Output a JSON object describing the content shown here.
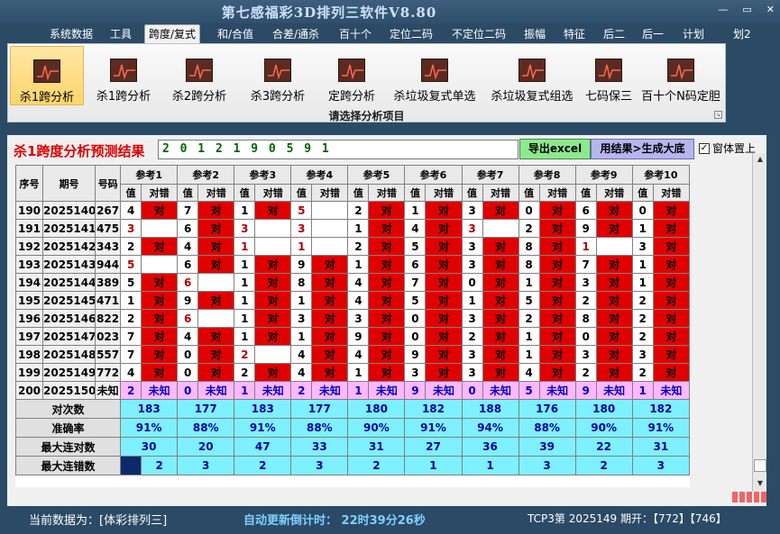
{
  "window": {
    "title": "第七感福彩3D排列三软件V8.80",
    "minimize": "—",
    "restore": "▭",
    "close": "✕"
  },
  "menu": [
    "系统数据",
    "工具",
    "跨度/复式",
    "和/合值",
    "合差/通杀",
    "百十个",
    "定位二码",
    "不定位二码",
    "振幅",
    "特征",
    "后二",
    "后一",
    "计划",
    "划2"
  ],
  "ribbon": {
    "buttons": [
      "杀1跨分析",
      "杀1跨分析",
      "杀2跨分析",
      "杀3跨分析",
      "定跨分析",
      "杀垃圾复式单选",
      "杀垃圾复式组选",
      "七码保三",
      "百十个N码定胆"
    ],
    "group_caption": "请选择分析项目",
    "launcher": "↘"
  },
  "panel": {
    "title": "杀1跨度分析预测结果",
    "result": "2 0 1 2 1 9 0 5 9 1",
    "export_btn": "导出excel",
    "gen_btn": "用结果>生成大底",
    "topmost_check": "✓",
    "topmost_label": "窗体置上"
  },
  "table": {
    "h_seq": "序号",
    "h_period": "期号",
    "h_num": "号码",
    "h_val": "值",
    "h_dc": "对错",
    "refs": [
      "参考1",
      "参考2",
      "参考3",
      "参考4",
      "参考5",
      "参考6",
      "参考7",
      "参考8",
      "参考9",
      "参考10"
    ],
    "rows": [
      {
        "seq": "190",
        "period": "2025140",
        "num": "267",
        "cells": [
          [
            "4",
            "对"
          ],
          [
            "7",
            "对"
          ],
          [
            "1",
            "对"
          ],
          [
            "5",
            ""
          ],
          [
            "2",
            "对"
          ],
          [
            "1",
            "对"
          ],
          [
            "3",
            "对"
          ],
          [
            "0",
            "对"
          ],
          [
            "6",
            "对"
          ],
          [
            "0",
            "对"
          ]
        ]
      },
      {
        "seq": "191",
        "period": "2025141",
        "num": "475",
        "cells": [
          [
            "3",
            ""
          ],
          [
            "6",
            "对"
          ],
          [
            "3",
            ""
          ],
          [
            "3",
            ""
          ],
          [
            "1",
            "对"
          ],
          [
            "4",
            "对"
          ],
          [
            "3",
            ""
          ],
          [
            "2",
            "对"
          ],
          [
            "9",
            "对"
          ],
          [
            "1",
            "对"
          ]
        ]
      },
      {
        "seq": "192",
        "period": "2025142",
        "num": "343",
        "cells": [
          [
            "2",
            "对"
          ],
          [
            "4",
            "对"
          ],
          [
            "1",
            ""
          ],
          [
            "1",
            ""
          ],
          [
            "2",
            "对"
          ],
          [
            "5",
            "对"
          ],
          [
            "3",
            "对"
          ],
          [
            "8",
            "对"
          ],
          [
            "1",
            ""
          ],
          [
            "3",
            "对"
          ]
        ]
      },
      {
        "seq": "193",
        "period": "2025143",
        "num": "944",
        "cells": [
          [
            "5",
            ""
          ],
          [
            "6",
            "对"
          ],
          [
            "1",
            "对"
          ],
          [
            "9",
            "对"
          ],
          [
            "1",
            "对"
          ],
          [
            "6",
            "对"
          ],
          [
            "3",
            "对"
          ],
          [
            "8",
            "对"
          ],
          [
            "7",
            "对"
          ],
          [
            "1",
            "对"
          ]
        ]
      },
      {
        "seq": "194",
        "period": "2025144",
        "num": "389",
        "cells": [
          [
            "5",
            "对"
          ],
          [
            "6",
            ""
          ],
          [
            "1",
            "对"
          ],
          [
            "8",
            "对"
          ],
          [
            "4",
            "对"
          ],
          [
            "7",
            "对"
          ],
          [
            "0",
            "对"
          ],
          [
            "1",
            "对"
          ],
          [
            "3",
            "对"
          ],
          [
            "1",
            "对"
          ]
        ]
      },
      {
        "seq": "195",
        "period": "2025145",
        "num": "471",
        "cells": [
          [
            "1",
            "对"
          ],
          [
            "9",
            "对"
          ],
          [
            "1",
            "对"
          ],
          [
            "1",
            "对"
          ],
          [
            "4",
            "对"
          ],
          [
            "5",
            "对"
          ],
          [
            "1",
            "对"
          ],
          [
            "5",
            "对"
          ],
          [
            "2",
            "对"
          ],
          [
            "2",
            "对"
          ]
        ]
      },
      {
        "seq": "196",
        "period": "2025146",
        "num": "822",
        "cells": [
          [
            "2",
            "对"
          ],
          [
            "6",
            ""
          ],
          [
            "1",
            "对"
          ],
          [
            "3",
            "对"
          ],
          [
            "3",
            "对"
          ],
          [
            "0",
            "对"
          ],
          [
            "3",
            "对"
          ],
          [
            "2",
            "对"
          ],
          [
            "8",
            "对"
          ],
          [
            "2",
            "对"
          ]
        ]
      },
      {
        "seq": "197",
        "period": "2025147",
        "num": "023",
        "cells": [
          [
            "7",
            "对"
          ],
          [
            "4",
            "对"
          ],
          [
            "1",
            "对"
          ],
          [
            "1",
            "对"
          ],
          [
            "9",
            "对"
          ],
          [
            "0",
            "对"
          ],
          [
            "2",
            "对"
          ],
          [
            "1",
            "对"
          ],
          [
            "0",
            "对"
          ],
          [
            "2",
            "对"
          ]
        ]
      },
      {
        "seq": "198",
        "period": "2025148",
        "num": "557",
        "cells": [
          [
            "7",
            "对"
          ],
          [
            "0",
            "对"
          ],
          [
            "2",
            ""
          ],
          [
            "4",
            "对"
          ],
          [
            "4",
            "对"
          ],
          [
            "9",
            "对"
          ],
          [
            "3",
            "对"
          ],
          [
            "1",
            "对"
          ],
          [
            "3",
            "对"
          ],
          [
            "3",
            "对"
          ]
        ]
      },
      {
        "seq": "199",
        "period": "2025149",
        "num": "772",
        "cells": [
          [
            "4",
            "对"
          ],
          [
            "0",
            "对"
          ],
          [
            "2",
            "对"
          ],
          [
            "4",
            "对"
          ],
          [
            "1",
            "对"
          ],
          [
            "3",
            "对"
          ],
          [
            "3",
            "对"
          ],
          [
            "4",
            "对"
          ],
          [
            "2",
            "对"
          ],
          [
            "2",
            "对"
          ]
        ]
      }
    ],
    "unknown_row": {
      "seq": "200",
      "period": "2025150",
      "num": "未知",
      "vals": [
        "2",
        "0",
        "1",
        "2",
        "1",
        "9",
        "0",
        "5",
        "9",
        "1"
      ],
      "label": "未知"
    },
    "stats": [
      {
        "label": "对次数",
        "vals": [
          "183",
          "177",
          "183",
          "177",
          "180",
          "182",
          "188",
          "176",
          "180",
          "182"
        ]
      },
      {
        "label": "准确率",
        "vals": [
          "91%",
          "88%",
          "91%",
          "88%",
          "90%",
          "91%",
          "94%",
          "88%",
          "90%",
          "91%"
        ]
      },
      {
        "label": "最大连对数",
        "vals": [
          "30",
          "20",
          "47",
          "33",
          "31",
          "27",
          "36",
          "39",
          "22",
          "31"
        ]
      },
      {
        "label": "最大连错数",
        "vals": [
          "2",
          "3",
          "2",
          "3",
          "2",
          "1",
          "1",
          "3",
          "2",
          "3"
        ]
      }
    ]
  },
  "scroll": {
    "up": "▲",
    "down": "▼"
  },
  "status": {
    "current": "当前数据为：[体彩排列三]",
    "countdown": "自动更新倒计时： 22时39分26秒",
    "issue": "TCP3第 2025149 期开：【772】【746】"
  },
  "colors": {
    "hit": "#e00000",
    "unknown_row": "#ffb8ff",
    "stats": "#7ff0ff",
    "title_red": "#e00000"
  }
}
